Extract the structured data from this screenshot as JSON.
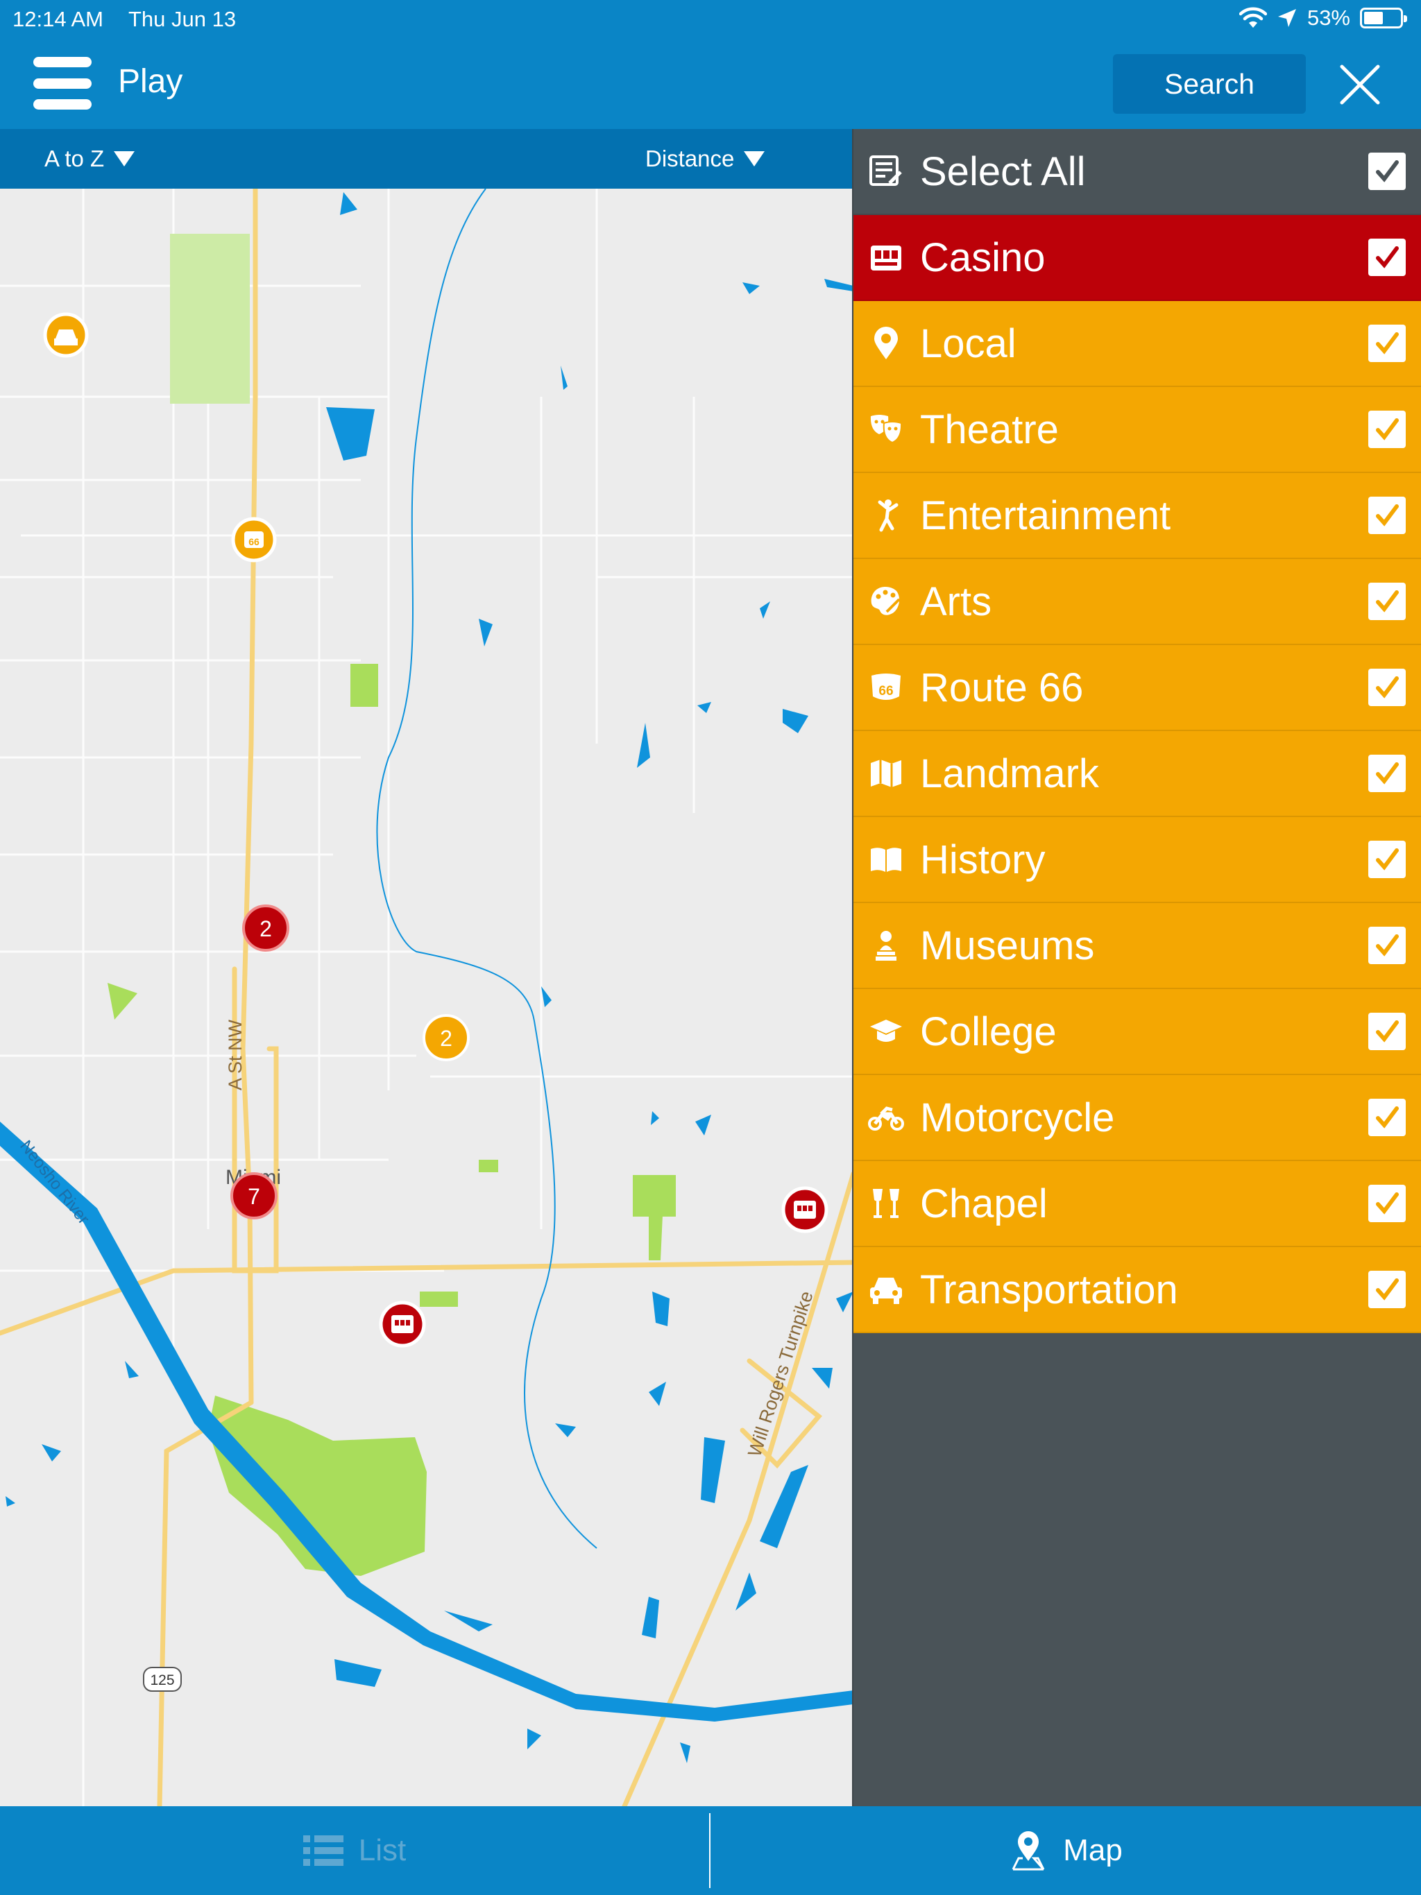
{
  "status": {
    "time": "12:14 AM",
    "date": "Thu Jun 13",
    "battery": "53%",
    "battery_level": 0.53
  },
  "header": {
    "title": "Play",
    "search_label": "Search"
  },
  "sort_bar": {
    "sort_name": "A to Z",
    "sort_distance": "Distance"
  },
  "map": {
    "street_label": "A St NW",
    "city_label": "Miami",
    "river_label": "Neosho River",
    "turnpike_label": "Will Rogers Turnpike",
    "route_shield": "125",
    "cluster_counts": [
      "2",
      "2",
      "7"
    ],
    "colors": {
      "water": "#0f93dc",
      "park": "#a9dd5b",
      "road": "#f6d37a",
      "casino_marker": "#bc0109",
      "category_marker": "#f4a702"
    }
  },
  "filter": {
    "select_all": "Select All",
    "items": [
      {
        "label": "Casino",
        "icon": "slot-machine-icon",
        "checked": true
      },
      {
        "label": "Local",
        "icon": "map-pin-icon",
        "checked": true
      },
      {
        "label": "Theatre",
        "icon": "theatre-masks-icon",
        "checked": true
      },
      {
        "label": "Entertainment",
        "icon": "dancer-icon",
        "checked": true
      },
      {
        "label": "Arts",
        "icon": "palette-icon",
        "checked": true
      },
      {
        "label": "Route 66",
        "icon": "route-66-icon",
        "checked": true
      },
      {
        "label": "Landmark",
        "icon": "folded-map-icon",
        "checked": true
      },
      {
        "label": "History",
        "icon": "open-book-icon",
        "checked": true
      },
      {
        "label": "Museums",
        "icon": "bust-icon",
        "checked": true
      },
      {
        "label": "College",
        "icon": "graduation-cap-icon",
        "checked": true
      },
      {
        "label": "Motorcycle",
        "icon": "motorcycle-icon",
        "checked": true
      },
      {
        "label": "Chapel",
        "icon": "champagne-glasses-icon",
        "checked": true
      },
      {
        "label": "Transportation",
        "icon": "car-icon",
        "checked": true
      }
    ],
    "colors": {
      "casino": "#bc0109",
      "category": "#f4a702",
      "panel": "#4a5358"
    }
  },
  "tabs": {
    "list": "List",
    "map": "Map"
  }
}
